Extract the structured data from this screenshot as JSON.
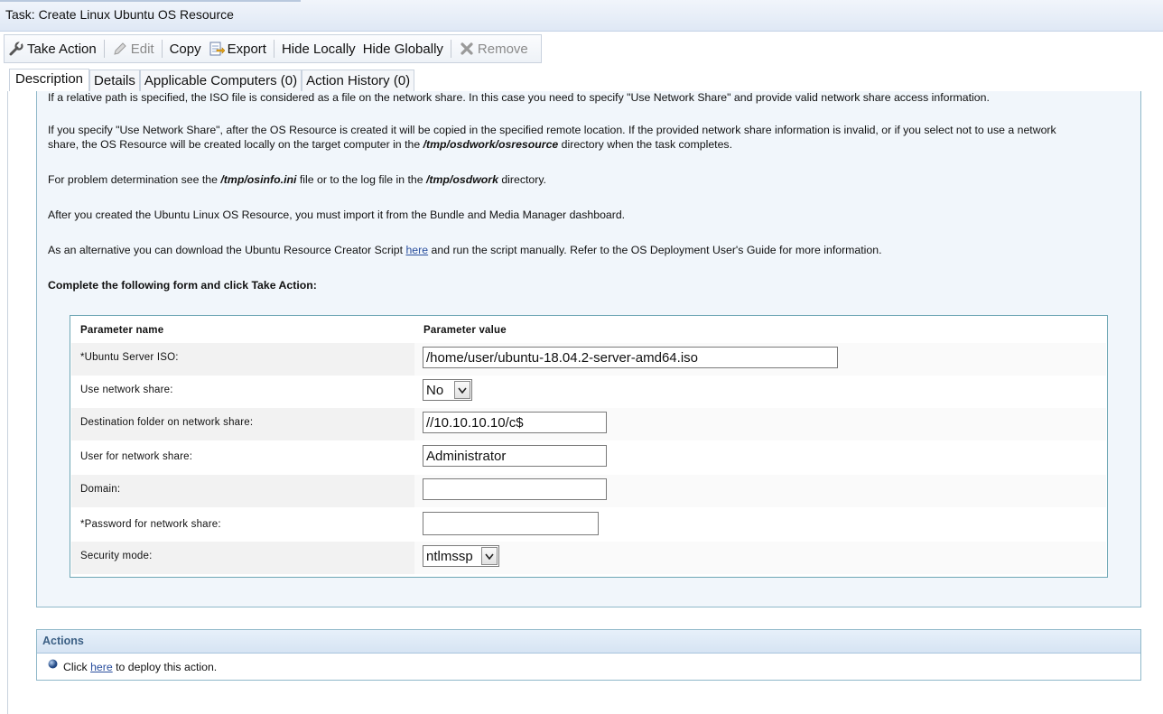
{
  "window": {
    "title": "Task: Create Linux Ubuntu OS Resource"
  },
  "toolbar": {
    "take_action": "Take Action",
    "edit": "Edit",
    "copy": "Copy",
    "export": "Export",
    "hide_locally": "Hide Locally",
    "hide_globally": "Hide Globally",
    "remove": "Remove"
  },
  "tabs": [
    {
      "label": "Description",
      "active": true
    },
    {
      "label": "Details"
    },
    {
      "label": "Applicable Computers (0)"
    },
    {
      "label": "Action History (0)"
    }
  ],
  "description": {
    "line_cut": "If a relative path is specified, the ISO file is considered as a file on the network share. In this case you need to specify \"Use Network Share\" and provide valid network share access information.",
    "p1_a": "If you specify \"Use Network Share\", after the OS Resource is created it will be copied in the specified remote location. If the provided network share information is invalid, or if you select not to use a network",
    "p1_b_pre": "share, the OS Resource will be created locally on the target computer in the ",
    "p1_b_path": "/tmp/osdwork/osresource",
    "p1_b_post": " directory when the task completes.",
    "p2_pre": "For problem determination see the ",
    "p2_file": "/tmp/osinfo.ini",
    "p2_mid": " file or to the log file in the ",
    "p2_dir": "/tmp/osdwork",
    "p2_post": " directory.",
    "p3": "After you created the Ubuntu Linux OS Resource, you must import it from the Bundle and Media Manager dashboard.",
    "p4_pre": "As an alternative you can download the Ubuntu Resource Creator Script ",
    "p4_link": "here",
    "p4_post": " and run the script manually. Refer to the OS Deployment User's Guide for more information.",
    "form_intro": "Complete the following form and click Take Action:"
  },
  "form": {
    "header_name": "Parameter name",
    "header_value": "Parameter value",
    "iso_label": "*Ubuntu Server ISO:",
    "iso_value": "/home/user/ubuntu-18.04.2-server-amd64.iso",
    "use_share_label": "Use network share:",
    "use_share_value": "No",
    "dest_label": "Destination folder on network share:",
    "dest_value": "//10.10.10.10/c$",
    "user_label": "User for network share:",
    "user_value": "Administrator",
    "domain_label": "Domain:",
    "domain_value": "",
    "password_label": "*Password for network share:",
    "password_value": "",
    "security_label": "Security mode:",
    "security_value": "ntlmssp"
  },
  "actions": {
    "title": "Actions",
    "click_pre": "Click ",
    "click_link": "here",
    "click_post": " to deploy this action."
  }
}
